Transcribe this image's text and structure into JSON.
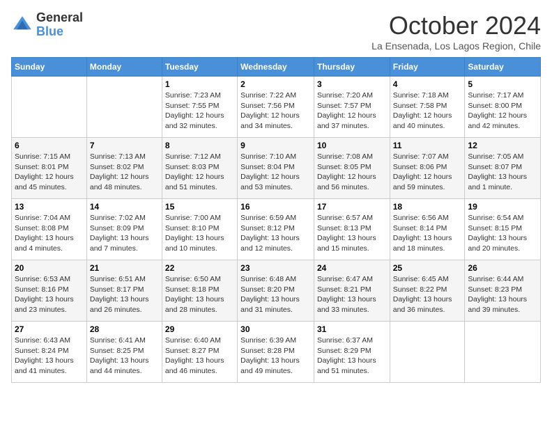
{
  "header": {
    "logo_general": "General",
    "logo_blue": "Blue",
    "month_title": "October 2024",
    "location": "La Ensenada, Los Lagos Region, Chile"
  },
  "weekdays": [
    "Sunday",
    "Monday",
    "Tuesday",
    "Wednesday",
    "Thursday",
    "Friday",
    "Saturday"
  ],
  "weeks": [
    [
      {
        "day": "",
        "info": ""
      },
      {
        "day": "",
        "info": ""
      },
      {
        "day": "1",
        "info": "Sunrise: 7:23 AM\nSunset: 7:55 PM\nDaylight: 12 hours and 32 minutes."
      },
      {
        "day": "2",
        "info": "Sunrise: 7:22 AM\nSunset: 7:56 PM\nDaylight: 12 hours and 34 minutes."
      },
      {
        "day": "3",
        "info": "Sunrise: 7:20 AM\nSunset: 7:57 PM\nDaylight: 12 hours and 37 minutes."
      },
      {
        "day": "4",
        "info": "Sunrise: 7:18 AM\nSunset: 7:58 PM\nDaylight: 12 hours and 40 minutes."
      },
      {
        "day": "5",
        "info": "Sunrise: 7:17 AM\nSunset: 8:00 PM\nDaylight: 12 hours and 42 minutes."
      }
    ],
    [
      {
        "day": "6",
        "info": "Sunrise: 7:15 AM\nSunset: 8:01 PM\nDaylight: 12 hours and 45 minutes."
      },
      {
        "day": "7",
        "info": "Sunrise: 7:13 AM\nSunset: 8:02 PM\nDaylight: 12 hours and 48 minutes."
      },
      {
        "day": "8",
        "info": "Sunrise: 7:12 AM\nSunset: 8:03 PM\nDaylight: 12 hours and 51 minutes."
      },
      {
        "day": "9",
        "info": "Sunrise: 7:10 AM\nSunset: 8:04 PM\nDaylight: 12 hours and 53 minutes."
      },
      {
        "day": "10",
        "info": "Sunrise: 7:08 AM\nSunset: 8:05 PM\nDaylight: 12 hours and 56 minutes."
      },
      {
        "day": "11",
        "info": "Sunrise: 7:07 AM\nSunset: 8:06 PM\nDaylight: 12 hours and 59 minutes."
      },
      {
        "day": "12",
        "info": "Sunrise: 7:05 AM\nSunset: 8:07 PM\nDaylight: 13 hours and 1 minute."
      }
    ],
    [
      {
        "day": "13",
        "info": "Sunrise: 7:04 AM\nSunset: 8:08 PM\nDaylight: 13 hours and 4 minutes."
      },
      {
        "day": "14",
        "info": "Sunrise: 7:02 AM\nSunset: 8:09 PM\nDaylight: 13 hours and 7 minutes."
      },
      {
        "day": "15",
        "info": "Sunrise: 7:00 AM\nSunset: 8:10 PM\nDaylight: 13 hours and 10 minutes."
      },
      {
        "day": "16",
        "info": "Sunrise: 6:59 AM\nSunset: 8:12 PM\nDaylight: 13 hours and 12 minutes."
      },
      {
        "day": "17",
        "info": "Sunrise: 6:57 AM\nSunset: 8:13 PM\nDaylight: 13 hours and 15 minutes."
      },
      {
        "day": "18",
        "info": "Sunrise: 6:56 AM\nSunset: 8:14 PM\nDaylight: 13 hours and 18 minutes."
      },
      {
        "day": "19",
        "info": "Sunrise: 6:54 AM\nSunset: 8:15 PM\nDaylight: 13 hours and 20 minutes."
      }
    ],
    [
      {
        "day": "20",
        "info": "Sunrise: 6:53 AM\nSunset: 8:16 PM\nDaylight: 13 hours and 23 minutes."
      },
      {
        "day": "21",
        "info": "Sunrise: 6:51 AM\nSunset: 8:17 PM\nDaylight: 13 hours and 26 minutes."
      },
      {
        "day": "22",
        "info": "Sunrise: 6:50 AM\nSunset: 8:18 PM\nDaylight: 13 hours and 28 minutes."
      },
      {
        "day": "23",
        "info": "Sunrise: 6:48 AM\nSunset: 8:20 PM\nDaylight: 13 hours and 31 minutes."
      },
      {
        "day": "24",
        "info": "Sunrise: 6:47 AM\nSunset: 8:21 PM\nDaylight: 13 hours and 33 minutes."
      },
      {
        "day": "25",
        "info": "Sunrise: 6:45 AM\nSunset: 8:22 PM\nDaylight: 13 hours and 36 minutes."
      },
      {
        "day": "26",
        "info": "Sunrise: 6:44 AM\nSunset: 8:23 PM\nDaylight: 13 hours and 39 minutes."
      }
    ],
    [
      {
        "day": "27",
        "info": "Sunrise: 6:43 AM\nSunset: 8:24 PM\nDaylight: 13 hours and 41 minutes."
      },
      {
        "day": "28",
        "info": "Sunrise: 6:41 AM\nSunset: 8:25 PM\nDaylight: 13 hours and 44 minutes."
      },
      {
        "day": "29",
        "info": "Sunrise: 6:40 AM\nSunset: 8:27 PM\nDaylight: 13 hours and 46 minutes."
      },
      {
        "day": "30",
        "info": "Sunrise: 6:39 AM\nSunset: 8:28 PM\nDaylight: 13 hours and 49 minutes."
      },
      {
        "day": "31",
        "info": "Sunrise: 6:37 AM\nSunset: 8:29 PM\nDaylight: 13 hours and 51 minutes."
      },
      {
        "day": "",
        "info": ""
      },
      {
        "day": "",
        "info": ""
      }
    ]
  ]
}
